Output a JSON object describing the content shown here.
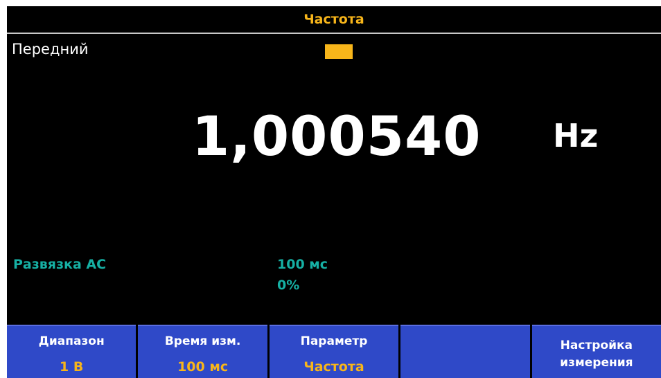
{
  "screen": {
    "title": "Частота",
    "input_label": "Передний",
    "reading": {
      "value": "1,000540",
      "unit": "Hz"
    },
    "status": {
      "coupling": "Развязка АС",
      "gate_time": "100 мс",
      "percent": "0%"
    },
    "indicator_color": "#f7b51a"
  },
  "softkeys": [
    {
      "label": "Диапазон",
      "value": "1 В"
    },
    {
      "label": "Время изм.",
      "value": "100 мс"
    },
    {
      "label": "Параметр",
      "value": "Частота"
    },
    {
      "label": "",
      "value": ""
    },
    {
      "line1": "Настройка",
      "line2": "измерения"
    }
  ],
  "colors": {
    "background": "#000000",
    "title": "#f7b51a",
    "status_text": "#16b0a4",
    "softkey_bg": "#2f49c8",
    "softkey_value": "#f7b51a"
  }
}
